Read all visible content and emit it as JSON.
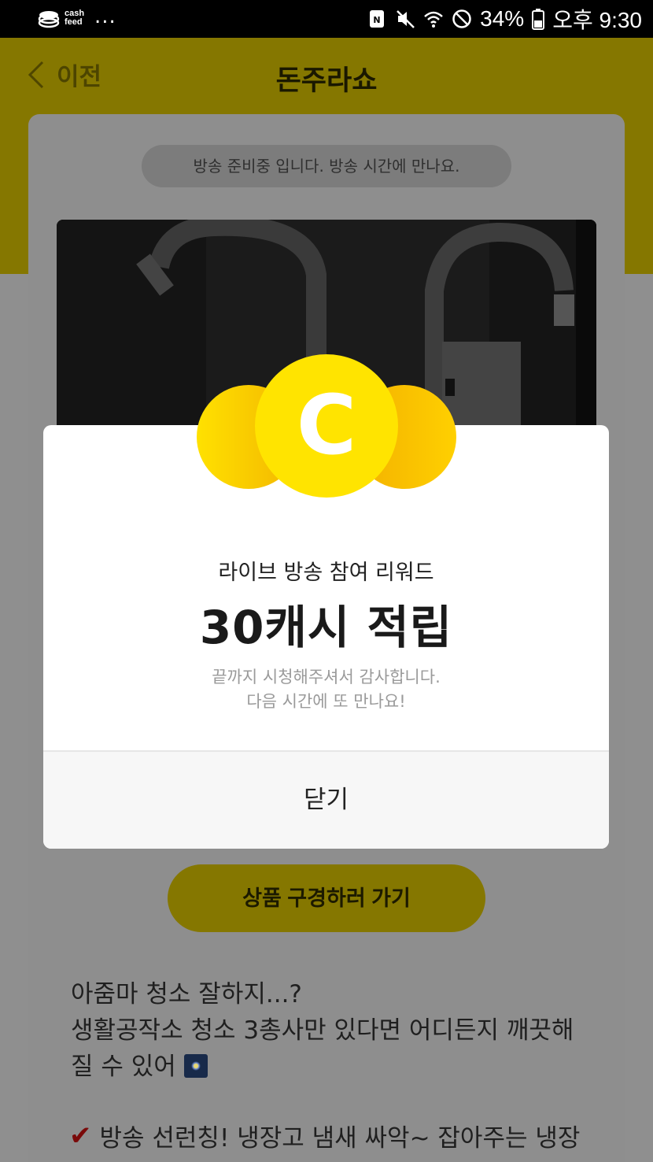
{
  "status_bar": {
    "app_name_line1": "cash",
    "app_name_line2": "feed",
    "notification_more": "...",
    "battery_percent": "34%",
    "clock": "오후 9:30"
  },
  "header": {
    "back_label": "이전",
    "title": "돈주라쇼"
  },
  "broadcast": {
    "notice": "방송 준비중 입니다. 방송 시간에 만나요."
  },
  "modal": {
    "coin_letter": "C",
    "subtitle": "라이브 방송 참여 리워드",
    "reward": "30캐시 적립",
    "message_line1": "끝까지 시청해주셔서 감사합니다.",
    "message_line2": "다음 시간에 또 만나요!",
    "close_label": "닫기"
  },
  "shop_button_label": "상품 구경하러 가기",
  "description": {
    "line1": "아줌마 청소 잘하지...?",
    "line2": "생활공작소 청소 3총사만 있다면 어디든지 깨끗해",
    "line3": "질 수 있어",
    "bullet": "방송 선런칭! 냉장고 냄새 싸악~ 잡아주는 냉장"
  },
  "colors": {
    "brand_yellow": "#FFE400",
    "coin_orange": "#F5B800"
  }
}
